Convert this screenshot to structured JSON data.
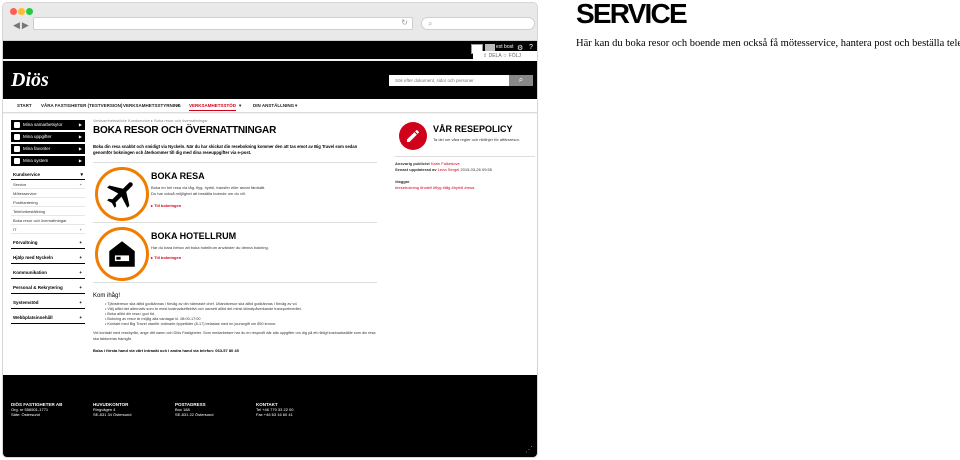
{
  "right_panel": {
    "title": "SERVICE",
    "subtitle": "Här kan du boka resor och boende men också få mötesservice, hantera post och beställa telefon."
  },
  "colors": {
    "accent_red": "#d0021b",
    "orange": "#f07d00",
    "brand_black": "#000000"
  },
  "browser": {
    "icons": [
      "back-icon",
      "forward-icon",
      "reload-icon",
      "search-icon"
    ]
  },
  "topbar": {
    "user": "ext bost",
    "icons": [
      "gear-icon",
      "help-icon"
    ]
  },
  "follow": {
    "dela": "DELA",
    "folj": "FÖLJ"
  },
  "header": {
    "logo": "Diös",
    "search_placeholder": "Sök efter dokument, sidor och personer"
  },
  "nav": {
    "items": [
      "START",
      "VÅRA FASTIGHETER (TESTVERSION)",
      "VERKSAMHETSSTYRNING",
      "VERKSAMHETSSTÖD",
      "DIN ANSTÄLLNING"
    ]
  },
  "sidebar": {
    "top_buttons": [
      "Mina samarbetsytor",
      "Mina uppgifter",
      "Mina favoriter",
      "Mina system"
    ],
    "section": "Kundservice",
    "items": [
      "Service",
      "Mötesservice",
      "Posthantering",
      "Telefonbeställning",
      "Boka resor och övernattningar",
      "IT"
    ],
    "groups": [
      "Förvaltning",
      "Hjälp med Nyckeln",
      "Kommunikation",
      "Personal & Rekrytering",
      "Systemstöd",
      "Webbplatsinnehåll"
    ]
  },
  "main": {
    "breadcrumb": "Verksamhetsstöd ▸ Kundservice ▸ Boka resor och övernattningar",
    "title": "BOKA RESOR OCH ÖVERNATTNINGAR",
    "intro": "Boka din resa snabbt och smidigt via Nyckeln. När du har skickat din resebokning kommer den att tas emot av Big Travel som sedan genomför bokningen och återkommer till dig med dina reseuppgifter via e-post.",
    "boka_resa": {
      "title": "BOKA RESA",
      "desc1": "Boka en hel resa via tåg, flyg, hyrbil, transfer eller annat färdsätt.",
      "desc2": "Du har också möjlighet att beställa boende om du vill.",
      "link": "▸ Till bokningen"
    },
    "boka_hotell": {
      "title": "BOKA HOTELLRUM",
      "desc": "Har du bara behov att boka hotellrum använder du denna bokning.",
      "link": "▸ Till bokningen"
    },
    "kom_ihag": "Kom ihåg!",
    "bullets": [
      "Tjänsteresor ska alltid godkännas i förväg av din närmaste chef. Utlandsresor ska alltid godkännas i förväg av vd.",
      "Välj alltid det alternativ som är mest kostnadseffektivt och oavsett alltid det minst klimatpåverkande transportmedlet.",
      "Boka alltid din resa i god tid.",
      "Bokning av resor är möjlig alla vardagar kl. 08:00-17:00",
      "Kontakt med Big Travel utanför ordinarie öppettider (8-17) belastas med en jouravgift om 850 kronor."
    ],
    "contact": "Vid kontakt med resebyrån, ange ditt namn och Diös Fastigheter. Som medarbetare har du en resprofil där alla uppgifter om dig på ett riktigt kostnadsställe som din resa ska faktureras framgår.",
    "footer_note": "Boka i första hand via vårt intranät och i andra hand via telefon: 063-57 80 45"
  },
  "policy": {
    "title": "VÅR RESEPOLICY",
    "desc": "Ta del om våra regler och riktlinjer för affärsresor.",
    "ansvarig_label": "Ansvarig publicist",
    "ansvarig": "Karin Falkedove",
    "senast_label": "Senast uppdaterad av",
    "senast": "Lena Sergel",
    "date": "2015-03-26 09:55",
    "taggar_label": "#taggar",
    "tags": "#resebokning #hotell #flyg #tåg #hyrbil #resa"
  },
  "footer": {
    "cols": [
      {
        "head": "DIÖS FASTIGHETER AB",
        "l1": "Org. nr 556501-1771",
        "l2": "Säte: Östersund"
      },
      {
        "head": "HUVUDKONTOR",
        "l1": "Ringvägen 4",
        "l2": "SE-831 34 Östersund"
      },
      {
        "head": "POSTADRESS",
        "l1": "Box 188",
        "l2": "SE-831 22 Östersund"
      },
      {
        "head": "KONTAKT",
        "l1": "Tel +46 770 33 22 00",
        "l2": "Fax +46 63 16 60 41"
      }
    ]
  }
}
